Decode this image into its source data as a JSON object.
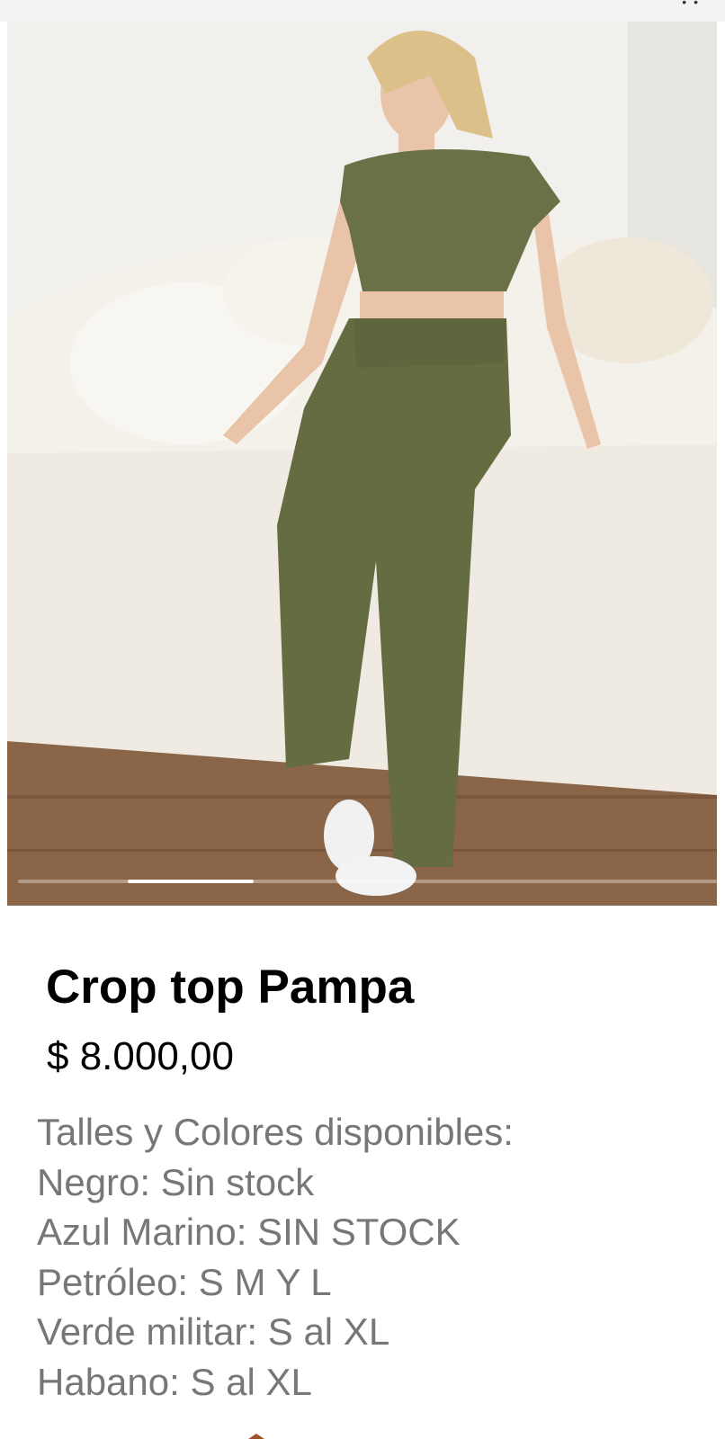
{
  "product": {
    "title": "Crop top Pampa",
    "price": "$ 8.000,00",
    "description_lines": [
      "Talles y Colores disponibles:",
      "Negro: Sin stock",
      "Azul Marino: SIN STOCK",
      "Petróleo: S M Y L",
      "Verde militar: S al XL",
      "Habano: S al XL"
    ]
  },
  "gallery": {
    "active_index_fraction": 0.2,
    "colors": {
      "garment": "#6b7147",
      "sofa": "#f4f1ea",
      "floor": "#8a6548",
      "wall": "#f1f0ec"
    }
  }
}
